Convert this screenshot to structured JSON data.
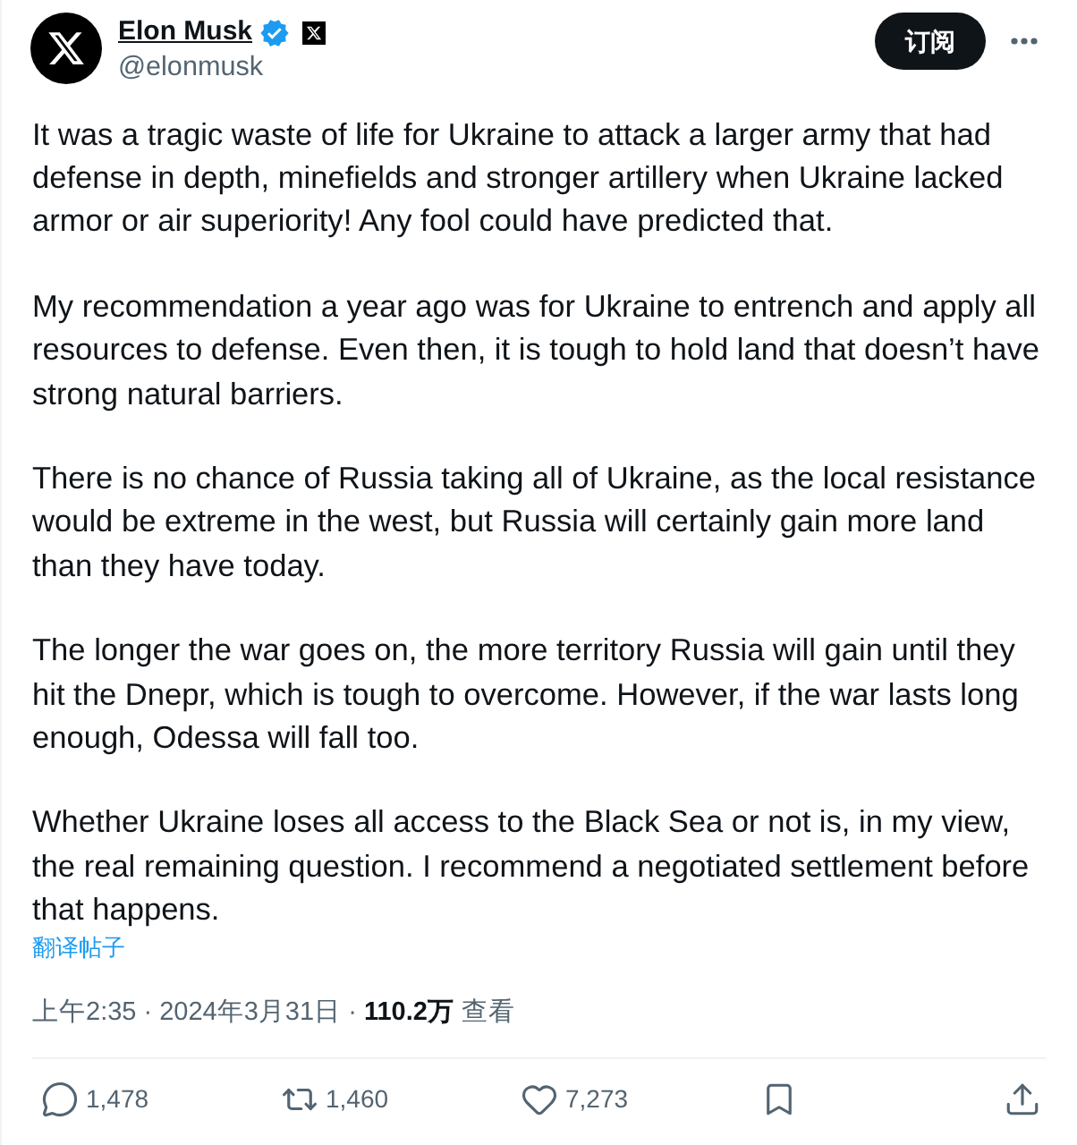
{
  "author": {
    "name": "Elon Musk",
    "handle": "@elonmusk",
    "verified": true
  },
  "subscribe_button": {
    "label": "订阅"
  },
  "paragraphs": [
    "It was a tragic waste of life for Ukraine to attack a larger army that had defense in depth, minefields and stronger artillery when Ukraine lacked armor or air superiority! Any fool could have predicted that.",
    "My recommendation a year ago was for Ukraine to entrench and apply all resources to defense. Even then, it is tough to hold land that doesn’t have strong natural barriers.",
    "There is no chance of Russia taking all of Ukraine, as the local resistance would be extreme in the west, but Russia will certainly gain more land than they have today.",
    "The longer the war goes on, the more territory Russia will gain until they hit the Dnepr, which is tough to overcome. However, if the war lasts long enough, Odessa will fall too.",
    "Whether Ukraine loses all access to the Black Sea or not is, in my view, the real remaining question. I recommend a negotiated settlement before that happens."
  ],
  "translate_link": "翻译帖子",
  "meta": "上午2:35 · 2024年3月31日 · **110.2万** 查看",
  "actions": [
    {
      "kind": "reply",
      "count": "1,478"
    },
    {
      "kind": "repost",
      "count": "1,460"
    },
    {
      "kind": "like",
      "count": "7,273"
    },
    {
      "kind": "bookmark"
    },
    {
      "kind": "share"
    }
  ]
}
